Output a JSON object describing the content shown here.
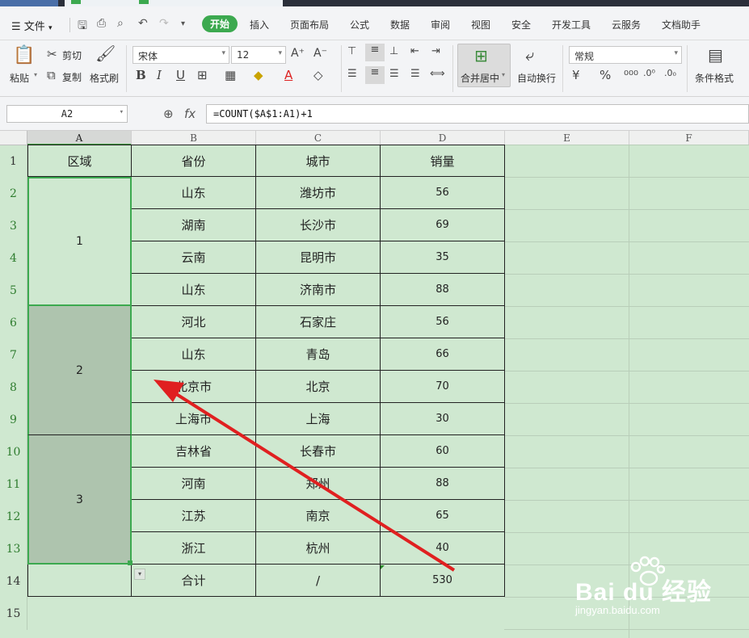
{
  "menu": {
    "file_label": "文件",
    "tabs": [
      "开始",
      "插入",
      "页面布局",
      "公式",
      "数据",
      "审阅",
      "视图",
      "安全",
      "开发工具",
      "云服务",
      "文档助手"
    ]
  },
  "ribbon": {
    "paste": "粘贴",
    "cut": "剪切",
    "copy": "复制",
    "format_painter": "格式刷",
    "font_name": "宋体",
    "font_size": "12",
    "merge_center": "合并居中",
    "wrap_text": "自动换行",
    "number_format": "常规",
    "conditional_format": "条件格式"
  },
  "formula_bar": {
    "name_box": "A2",
    "fx": "fx",
    "formula": "=COUNT($A$1:A1)+1"
  },
  "columns": [
    "A",
    "B",
    "C",
    "D",
    "E",
    "F"
  ],
  "rows": [
    "1",
    "2",
    "3",
    "4",
    "5",
    "6",
    "7",
    "8",
    "9",
    "10",
    "11",
    "12",
    "13",
    "14",
    "15"
  ],
  "sheet": {
    "headers": [
      "区域",
      "省份",
      "城市",
      "销量"
    ],
    "region_groups": [
      "1",
      "2",
      "3"
    ],
    "data": [
      [
        "山东",
        "潍坊市",
        "56"
      ],
      [
        "湖南",
        "长沙市",
        "69"
      ],
      [
        "云南",
        "昆明市",
        "35"
      ],
      [
        "山东",
        "济南市",
        "88"
      ],
      [
        "河北",
        "石家庄",
        "56"
      ],
      [
        "山东",
        "青岛",
        "66"
      ],
      [
        "北京市",
        "北京",
        "70"
      ],
      [
        "上海市",
        "上海",
        "30"
      ],
      [
        "吉林省",
        "长春市",
        "60"
      ],
      [
        "河南",
        "郑州",
        "88"
      ],
      [
        "江苏",
        "南京",
        "65"
      ],
      [
        "浙江",
        "杭州",
        "40"
      ]
    ],
    "total": [
      "合计",
      "/",
      "530"
    ]
  },
  "watermark": {
    "brand": "Bai du 经验",
    "url": "jingyan.baidu.com"
  },
  "colors": {
    "sheet_bg": "#cfe8d0",
    "selected_fill": "#aec4ae",
    "accent_green": "#3ca94f",
    "arrow_red": "#e02020"
  }
}
